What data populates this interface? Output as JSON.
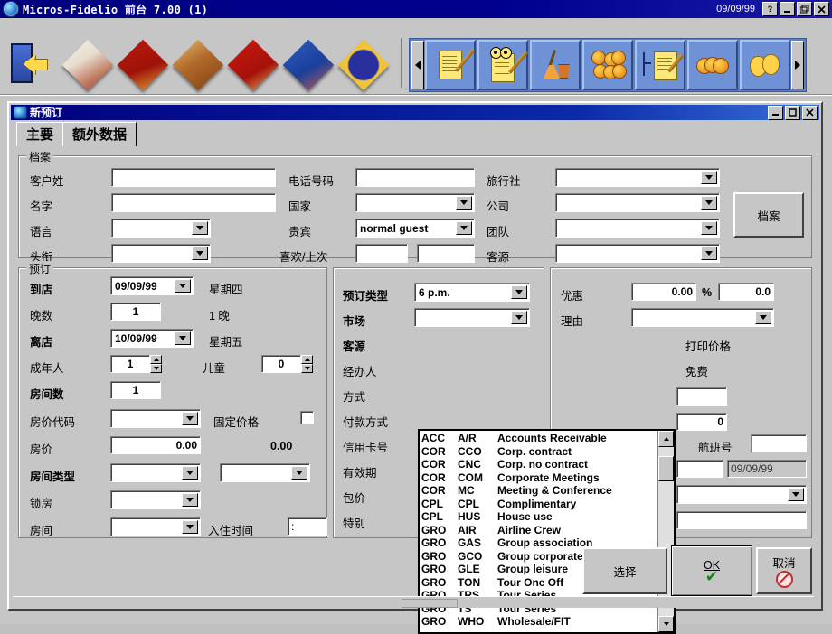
{
  "window": {
    "title": "Micros-Fidelio 前台 7.00 (1)",
    "date": "09/09/99",
    "buttons": {
      "help": "?",
      "minimize": "_",
      "restore": "❐",
      "close": "✕"
    }
  },
  "toolbar": {
    "icons": [
      "exit-door-icon",
      "bed-diamond-icon",
      "key-diamond-icon",
      "breakfast-diamond-icon",
      "candle-diamond-icon",
      "flowers-diamond-icon",
      "globe-diamond-icon",
      "scroll-left-icon",
      "reservation-icon",
      "inquiry-icon",
      "housekeeping-icon",
      "cashiering-icon",
      "posting-icon",
      "currency-icon",
      "theatre-icon",
      "scroll-right-icon"
    ]
  },
  "dialog": {
    "title": "新预订",
    "buttons": {
      "minimize": "_",
      "maximize": "❐",
      "close": "✕"
    },
    "tabs": [
      {
        "label": "主要",
        "active": true
      },
      {
        "label": "额外数据",
        "active": false
      }
    ],
    "profile_group": {
      "legend": "档案",
      "fields": {
        "last_name_label": "客户姓",
        "last_name_value": "",
        "first_name_label": "名字",
        "first_name_value": "",
        "language_label": "语言",
        "language_value": "",
        "title_label": "头衔",
        "title_value": "",
        "phone_label": "电话号码",
        "phone_value": "",
        "country_label": "国家",
        "country_value": "",
        "vip_label": "贵宾",
        "vip_value": "normal guest",
        "prefer_last_label": "喜欢/上次",
        "prefer_value": "",
        "last_value": "",
        "travel_agent_label": "旅行社",
        "travel_agent_value": "",
        "company_label": "公司",
        "company_value": "",
        "group_label": "团队",
        "group_value": "",
        "source_label": "客源",
        "source_value": ""
      },
      "profile_button": "档案"
    },
    "reservation_group": {
      "legend": "预订",
      "arrival_label": "到店",
      "arrival_value": "09/09/99",
      "arrival_weekday": "星期四",
      "nights_label": "晚数",
      "nights_value": "1",
      "nights_text": "1 晚",
      "departure_label": "离店",
      "departure_value": "10/09/99",
      "departure_weekday": "星期五",
      "adults_label": "成年人",
      "adults_value": "1",
      "children_label": "儿童",
      "children_value": "0",
      "rooms_label": "房间数",
      "rooms_value": "1",
      "rate_code_label": "房价代码",
      "rate_code_value": "",
      "fixed_rate_label": "固定价格",
      "fixed_rate_checked": false,
      "rate_label": "房价",
      "rate_value": "0.00",
      "rate_display": "0.00",
      "room_type_label": "房间类型",
      "room_type_value": "",
      "room_type2_value": "",
      "block_label": "锁房",
      "block_value": "",
      "room_label": "房间",
      "room_value": "",
      "arrival_time_label": "入住时间",
      "arrival_time_value": ":"
    },
    "detail_group": {
      "res_type_label": "预订类型",
      "res_type_value": "6 p.m.",
      "market_label": "市场",
      "market_value": "",
      "source_label": "客源",
      "source_value": "",
      "agent_label": "经办人",
      "agent_value": "",
      "method_label": "方式",
      "method_value": "",
      "payment_label": "付款方式",
      "payment_value": "",
      "card_no_label": "信用卡号",
      "card_no_value": "",
      "expiry_label": "有效期",
      "expiry_value": "",
      "package_label": "包价",
      "package_value": "",
      "special_label": "特别",
      "special_value": ""
    },
    "source_dropdown": {
      "name": "客源-list",
      "columns": [
        "group",
        "code",
        "description"
      ],
      "rows": [
        {
          "group": "ACC",
          "code": "A/R",
          "description": "Accounts Receivable"
        },
        {
          "group": "COR",
          "code": "CCO",
          "description": "Corp. contract"
        },
        {
          "group": "COR",
          "code": "CNC",
          "description": "Corp. no contract"
        },
        {
          "group": "COR",
          "code": "COM",
          "description": "Corporate Meetings"
        },
        {
          "group": "COR",
          "code": "MC",
          "description": "Meeting & Conference"
        },
        {
          "group": "CPL",
          "code": "CPL",
          "description": "Complimentary"
        },
        {
          "group": "CPL",
          "code": "HUS",
          "description": "House use"
        },
        {
          "group": "GRO",
          "code": "AIR",
          "description": "Airline Crew"
        },
        {
          "group": "GRO",
          "code": "GAS",
          "description": "Group association"
        },
        {
          "group": "GRO",
          "code": "GCO",
          "description": "Group corporate"
        },
        {
          "group": "GRO",
          "code": "GLE",
          "description": "Group leisure"
        },
        {
          "group": "GRO",
          "code": "TON",
          "description": "Tour One Off"
        },
        {
          "group": "GRO",
          "code": "TRS",
          "description": "Tour Series"
        },
        {
          "group": "GRO",
          "code": "TS",
          "description": "Tour Series"
        },
        {
          "group": "GRO",
          "code": "WHO",
          "description": "Wholesale/FIT"
        }
      ]
    },
    "right_group": {
      "discount_label": "优惠",
      "discount_amount": "0.00",
      "percent_sign": "%",
      "discount_percent": "0.0",
      "reason_label": "理由",
      "reason_value": "",
      "print_rate_label": "打印价格",
      "free_label": "免费",
      "field1_value": "",
      "field2_value": "0",
      "flight_label": "航班号",
      "flight_value": "",
      "field3_value": "",
      "date_value": "09/09/99",
      "combo_value": "",
      "note_value": ""
    },
    "footer_buttons": {
      "select": "选择",
      "ok": "OK",
      "cancel": "取消"
    }
  }
}
